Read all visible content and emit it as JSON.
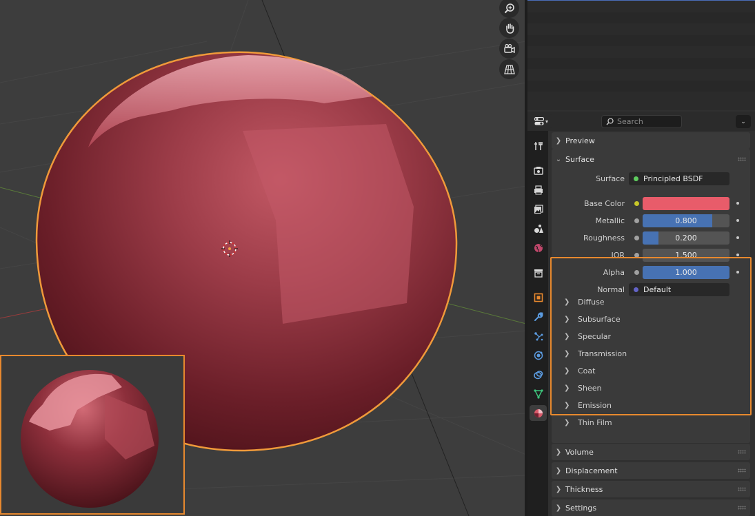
{
  "viewport": {
    "nav_buttons": [
      {
        "icon": "zoom-icon"
      },
      {
        "icon": "hand-pan-icon"
      },
      {
        "icon": "camera-view-icon"
      },
      {
        "icon": "perspective-grid-icon"
      }
    ]
  },
  "properties": {
    "search_placeholder": "Search",
    "tabs": [
      {
        "icon": "tool-icon"
      },
      {
        "icon": "render-icon"
      },
      {
        "icon": "output-icon"
      },
      {
        "icon": "view-layer-icon"
      },
      {
        "icon": "scene-icon"
      },
      {
        "icon": "world-icon"
      },
      {
        "icon": "collection-icon"
      },
      {
        "icon": "object-icon"
      },
      {
        "icon": "modifier-wrench-icon"
      },
      {
        "icon": "particles-icon"
      },
      {
        "icon": "physics-icon"
      },
      {
        "icon": "constraints-icon"
      },
      {
        "icon": "data-mesh-icon"
      },
      {
        "icon": "material-icon",
        "active": true
      }
    ],
    "preview_label": "Preview",
    "surface_panel": {
      "label": "Surface",
      "rows": {
        "surface": {
          "label": "Surface",
          "value": "Principled BSDF",
          "socket_color": "#5fcd5f"
        },
        "base_color": {
          "label": "Base Color",
          "color": "#e85c6a",
          "socket_color": "#c7c729"
        },
        "metallic": {
          "label": "Metallic",
          "value": "0.800",
          "fraction": 0.8
        },
        "roughness": {
          "label": "Roughness",
          "value": "0.200",
          "fraction": 0.2
        },
        "ior": {
          "label": "IOR",
          "value": "1.500"
        },
        "alpha": {
          "label": "Alpha",
          "value": "1.000",
          "fraction": 1.0
        },
        "normal": {
          "label": "Normal",
          "value": "Default",
          "socket_color": "#6363c7"
        }
      },
      "subpanels": [
        "Diffuse",
        "Subsurface",
        "Specular",
        "Transmission",
        "Coat",
        "Sheen",
        "Emission",
        "Thin Film"
      ]
    },
    "bottom_panels": [
      "Volume",
      "Displacement",
      "Thickness",
      "Settings"
    ]
  },
  "colors": {
    "accent_blue": "#4772b3",
    "selection_orange": "#e8892e",
    "grey_socket": "#a1a1a1"
  }
}
